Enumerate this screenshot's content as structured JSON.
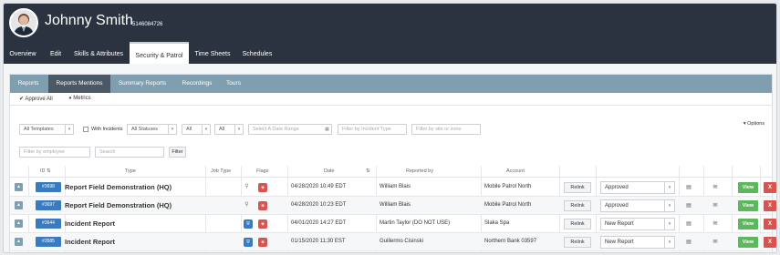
{
  "user": {
    "name": "Johnny Smith",
    "id": "5146084726"
  },
  "main_tabs": [
    {
      "label": "Overview"
    },
    {
      "label": "Edit"
    },
    {
      "label": "Skills & Attributes"
    },
    {
      "label": "Security & Patrol"
    },
    {
      "label": "Time Sheets"
    },
    {
      "label": "Schedules"
    }
  ],
  "sub_tabs": [
    {
      "label": "Reports"
    },
    {
      "label": "Reports Mentions"
    },
    {
      "label": "Summary Reports"
    },
    {
      "label": "Recordings"
    },
    {
      "label": "Tours"
    }
  ],
  "toolbar": {
    "approve_all": "Approve All",
    "metrics": "Metrics",
    "options": "Options"
  },
  "filters": {
    "templates": "All Templates",
    "with_incidents": "With Incidents",
    "statuses": "All Statuses",
    "all1": "All",
    "all2": "All",
    "date_range_placeholder": "Select A Date Range",
    "incident_type_placeholder": "Filter by Incident Type",
    "site_zone_placeholder": "Filter by site or zone",
    "employee_placeholder": "Filter by employee",
    "search_placeholder": "Search",
    "filter_button": "Filter"
  },
  "columns": {
    "id": "ID",
    "type": "Type",
    "job_type": "Job Type",
    "flags": "Flags",
    "date": "Date",
    "reported_by": "Reported by",
    "account": "Account"
  },
  "rows": [
    {
      "id": "#3698",
      "type": "Report Field Demonstration (HQ)",
      "date": "04/28/2020 10:49 EDT",
      "reported_by": "William Blais",
      "account": "Mobile Patrol North",
      "relink": "Relink",
      "status": "Approved",
      "view": "View",
      "delete": "X"
    },
    {
      "id": "#3697",
      "type": "Report Field Demonstration (HQ)",
      "date": "04/28/2020 10:23 EDT",
      "reported_by": "William Blais",
      "account": "Mobile Patrol North",
      "relink": "Relink",
      "status": "Approved",
      "view": "View",
      "delete": "X"
    },
    {
      "id": "#3644",
      "type": "Incident Report",
      "date": "04/01/2020 14:27 EDT",
      "reported_by": "Martin Taylor (DO NOT USE)",
      "account": "Slaka Spa",
      "relink": "Relink",
      "status": "New Report",
      "view": "View",
      "delete": "X"
    },
    {
      "id": "#3585",
      "type": "Incident Report",
      "date": "01/15/2020 11:30 EST",
      "reported_by": "Guillermo Cisinski",
      "account": "Northern Bank 03597",
      "relink": "Relink",
      "status": "New Report",
      "view": "View",
      "delete": "X"
    }
  ],
  "colors": {
    "header_bg": "#2b3340",
    "subnav_bg": "#7f9fb0",
    "id_badge": "#3a7bbf",
    "view_green": "#5cb85c",
    "delete_red": "#d9534f"
  }
}
